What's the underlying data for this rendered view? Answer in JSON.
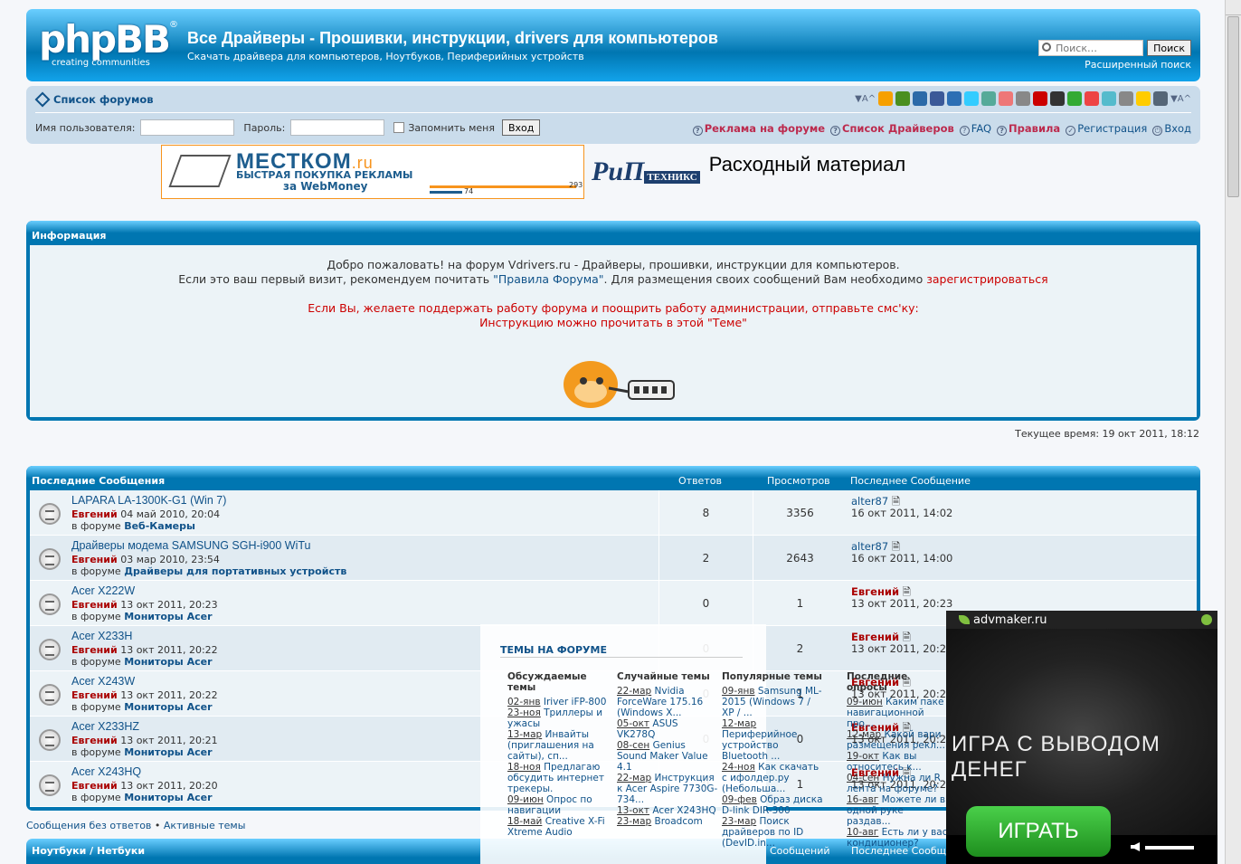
{
  "header": {
    "logo_text": "phpBB",
    "logo_tagline": "creating communities",
    "logo_reg": "®",
    "site_title": "Все Драйверы - Прошивки, инструкции, drivers для компьютеров",
    "site_description": "Скачать драйвера для компьютеров, Ноутбуков, Периферийных устройств",
    "search_placeholder": "Поиск…",
    "search_button": "Поиск",
    "advanced_search": "Расширенный поиск"
  },
  "navbar": {
    "crumb": "Список форумов",
    "font_size_left": "▼A^",
    "font_size_right": "▼A^",
    "username_label": "Имя пользователя:",
    "password_label": "Пароль:",
    "remember_label": "Запомнить меня",
    "login_button": "Вход",
    "links": {
      "ads": "Реклама на форуме",
      "drivers": "Список Драйверов",
      "faq": "FAQ",
      "rules": "Правила",
      "register": "Регистрация",
      "login": "Вход"
    },
    "share_colors": [
      "#f6a000",
      "#4a8f1f",
      "#2b6aa8",
      "#3b5998",
      "#2d6fb4",
      "#33ccff",
      "#5a9",
      "#e77",
      "#888",
      "#c00",
      "#333",
      "#3a3",
      "#e44",
      "#5bc",
      "#888",
      "#fc0",
      "#567"
    ]
  },
  "banners": {
    "mestkom_title": "МЕСТКОМ",
    "mestkom_tld": ".ru",
    "mestkom_line2": "БЫСТРАЯ ПОКУПКА РЕКЛАМЫ",
    "mestkom_line3": "за WebMoney",
    "mestkom_n1": "293",
    "mestkom_n2": "74",
    "rip_logo": "РиП",
    "rip_sub": "ТЕХНИКС",
    "rip_text": "Расходный материал"
  },
  "info": {
    "header": "Информация",
    "line1": "Добро пожаловать! на форум Vdrivers.ru - Драйверы, прошивки, инструкции для компьютеров.",
    "line2a": "Если это ваш первый визит, рекомендуем почитать ",
    "line2b": "\"Правила Форума\"",
    "line2c": ". Для размещения своих сообщений Вам необходимо ",
    "line2d": "зарегистрироваться",
    "line3": "Если Вы, желаете поддержать работу форума и поощрить работу администрации, отправьте смс'ку:",
    "line4a": "Инструкцию можно прочитать в этой ",
    "line4b": "\"Теме\""
  },
  "current_time": "Текущее время: 19 окт 2011, 18:12",
  "topics": {
    "header": "Последние Сообщения",
    "col_replies": "Ответов",
    "col_views": "Просмотров",
    "col_last": "Последнее Сообщение",
    "in_forum": "в форуме",
    "rows": [
      {
        "title": "LAPARA LA-1300K-G1 (Win 7)",
        "author": "Евгений",
        "date": "04 май 2010, 20:04",
        "forum": "Веб-Камеры",
        "replies": "8",
        "views": "3356",
        "last_user": "alter87",
        "last_date": "16 окт 2011, 14:02"
      },
      {
        "title": "Драйверы модема SAMSUNG SGH-i900 WiTu",
        "author": "Евгений",
        "date": "03 мар 2010, 23:54",
        "forum": "Драйверы для портативных устройств",
        "replies": "2",
        "views": "2643",
        "last_user": "alter87",
        "last_date": "16 окт 2011, 14:00"
      },
      {
        "title": "Acer X222W",
        "author": "Евгений",
        "date": "13 окт 2011, 20:23",
        "forum": "Мониторы Acer",
        "replies": "0",
        "views": "1",
        "last_user": "Евгений",
        "last_date": "13 окт 2011, 20:23"
      },
      {
        "title": "Acer X233H",
        "author": "Евгений",
        "date": "13 окт 2011, 20:22",
        "forum": "Мониторы Acer",
        "replies": "0",
        "views": "2",
        "last_user": "Евгений",
        "last_date": "13 окт 2011, 20:22"
      },
      {
        "title": "Acer X243W",
        "author": "Евгений",
        "date": "13 окт 2011, 20:22",
        "forum": "Мониторы Acer",
        "replies": "0",
        "views": "1",
        "last_user": "Евгений",
        "last_date": "13 окт 2011, 20:22"
      },
      {
        "title": "Acer X233HZ",
        "author": "Евгений",
        "date": "13 окт 2011, 20:21",
        "forum": "Мониторы Acer",
        "replies": "0",
        "views": "0",
        "last_user": "Евгений",
        "last_date": "13 окт 2011, 20:21"
      },
      {
        "title": "Acer X243HQ",
        "author": "Евгений",
        "date": "13 окт 2011, 20:20",
        "forum": "Мониторы Acer",
        "replies": "0",
        "views": "1",
        "last_user": "Евгений",
        "last_date": "13 окт 2011, 20:20"
      }
    ]
  },
  "footer_links": {
    "unanswered": "Сообщения без ответов",
    "sep": " • ",
    "active": "Активные темы"
  },
  "notebooks_header": "Ноутбуки / Нетбуки",
  "notebooks_col_msgs": "Сообщений",
  "notebooks_col_last": "Последнее Сообщение",
  "popup": {
    "title": "ТЕМЫ НА ФОРУМЕ",
    "cols": [
      {
        "head": "Обсуждаемые темы",
        "items": [
          [
            "02-янв",
            "Iriver iFP-800"
          ],
          [
            "23-ноя",
            "Триллеры и ужасы"
          ],
          [
            "13-мар",
            "Инвайты (приглашения на сайты), сп..."
          ],
          [
            "18-ноя",
            "Предлагаю обсудить интернет трекеры."
          ],
          [
            "09-июн",
            "Опрос по навигации"
          ],
          [
            "18-май",
            "Creative X-Fi Xtreme Audio"
          ]
        ]
      },
      {
        "head": "Случайные темы",
        "items": [
          [
            "22-мар",
            "Nvidia ForceWare 175.16 (Windows X..."
          ],
          [
            "05-окт",
            "ASUS VK278Q"
          ],
          [
            "08-сен",
            "Genius Sound Maker Value 4.1"
          ],
          [
            "22-мар",
            "Инструкция к Acer Aspire 7730G-734..."
          ],
          [
            "13-окт",
            "Acer X243HQ"
          ],
          [
            "23-мар",
            "Broadcom"
          ]
        ]
      },
      {
        "head": "Популярные темы",
        "items": [
          [
            "09-янв",
            "Samsung ML-2015 (Windows 7 / XP / ..."
          ],
          [
            "12-мар",
            "Периферийное устройство Bluetooth ..."
          ],
          [
            "24-ноя",
            "Как скачать с ифолдер.ру (Небольша..."
          ],
          [
            "09-фев",
            "Образ диска D-link DIR-300"
          ],
          [
            "23-мар",
            "Поиск драйверов по ID (DevID.in..."
          ]
        ]
      },
      {
        "head": "Последние опросы",
        "items": [
          [
            "09-июн",
            "Каким паке навигационной про..."
          ],
          [
            "12-мар",
            "Какой вари размещения рекл..."
          ],
          [
            "19-окт",
            "Как вы относитесь к..."
          ],
          [
            "04-сен",
            "Нужна ли R лента на форуме?"
          ],
          [
            "16-авг",
            "Можете ли в одной руке раздав..."
          ],
          [
            "10-авг",
            "Есть ли у вас кондиционер?"
          ]
        ]
      }
    ]
  },
  "advmaker": {
    "brand": "advmaker.ru",
    "video_text": "ИГРА С ВЫВОДОМ ДЕНЕГ",
    "play_button": "ИГРАТЬ"
  }
}
